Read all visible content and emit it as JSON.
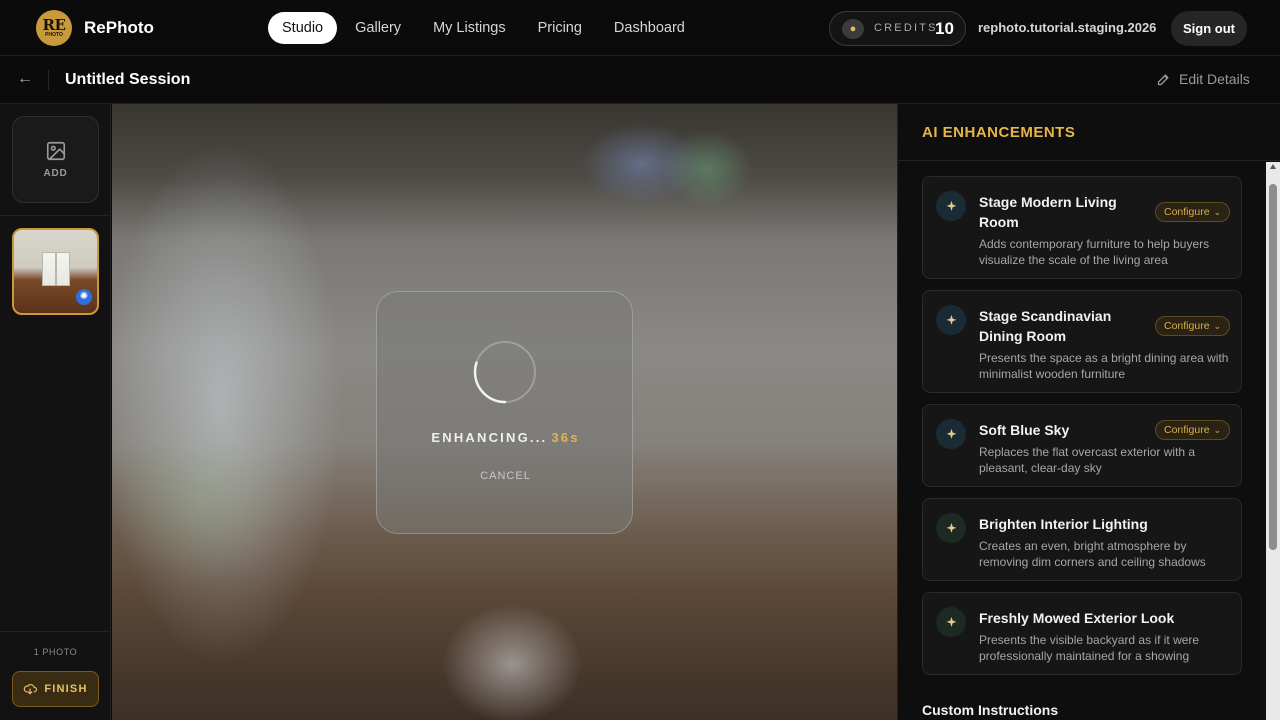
{
  "topbar": {
    "logo_text": "RE",
    "logo_sub": "PHOTO",
    "brand": "RePhoto",
    "nav": [
      {
        "label": "Studio",
        "active": true
      },
      {
        "label": "Gallery",
        "active": false
      },
      {
        "label": "My Listings",
        "active": false
      },
      {
        "label": "Pricing",
        "active": false
      },
      {
        "label": "Dashboard",
        "active": false
      }
    ],
    "credits_label": "CREDITS",
    "credits_value": "10",
    "user_email": "rephoto.tutorial.staging.20260...",
    "signout_label": "Sign out"
  },
  "session": {
    "title": "Untitled Session",
    "edit_label": "Edit Details"
  },
  "rail": {
    "add_label": "ADD",
    "photo_count": "1 PHOTO",
    "finish_label": "FINISH"
  },
  "enhancing": {
    "status": "ENHANCING...",
    "time": "36s",
    "cancel_label": "CANCEL",
    "progress": 0.3
  },
  "panel": {
    "title": "AI ENHANCEMENTS",
    "custom_title": "Custom Instructions",
    "enhancements": [
      {
        "title": "Stage Modern Living Room",
        "desc": "Adds contemporary furniture to help buyers visualize the scale of the living area",
        "configure": "Configure"
      },
      {
        "title": "Stage Scandinavian Dining Room",
        "desc": "Presents the space as a bright dining area with minimalist wooden furniture",
        "configure": "Configure"
      },
      {
        "title": "Soft Blue Sky",
        "desc": "Replaces the flat overcast exterior with a pleasant, clear-day sky",
        "configure": "Configure"
      },
      {
        "title": "Brighten Interior Lighting",
        "desc": "Creates an even, bright atmosphere by removing dim corners and ceiling shadows",
        "configure": ""
      },
      {
        "title": "Freshly Mowed Exterior Look",
        "desc": "Presents the visible backyard as if it were professionally maintained for a showing",
        "configure": ""
      }
    ]
  },
  "colors": {
    "accent_gold": "#e6b54c",
    "badge_blue": "#2f6fe0"
  }
}
